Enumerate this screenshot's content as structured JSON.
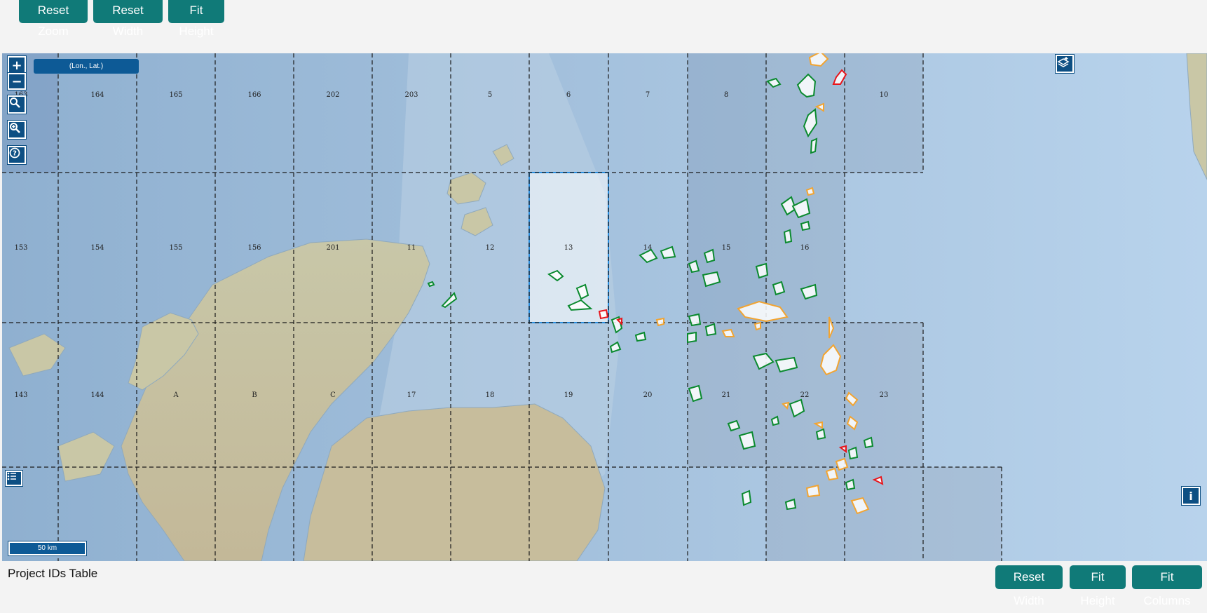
{
  "toolbar": {
    "reset_zoom": "Reset Zoom",
    "reset_width": "Reset Width",
    "fit_height": "Fit Height"
  },
  "map": {
    "coord_display": "(Lon., Lat.)",
    "scale_label": "50 km",
    "zoom_in": "+",
    "zoom_out": "−",
    "info": "i",
    "colors": {
      "sea": "#9bbcd9",
      "land": "#c9c6a4",
      "grid_line": "#1a1a1a",
      "selected_block": "#2b8fe0",
      "green_outline": "#0a8a2e",
      "orange_outline": "#f2a431",
      "red_outline": "#e8141b"
    },
    "row1_labels": [
      "163",
      "164",
      "165",
      "166",
      "202",
      "203",
      "5",
      "6",
      "7",
      "8",
      "10"
    ],
    "row2_labels": [
      "153",
      "154",
      "155",
      "156",
      "201",
      "11",
      "12",
      "13",
      "14",
      "15",
      "16"
    ],
    "row3_labels": [
      "143",
      "144",
      "A",
      "B",
      "C",
      "17",
      "18",
      "19",
      "20",
      "21",
      "22",
      "23"
    ]
  },
  "bottom": {
    "table_title": "Project IDs Table",
    "reset_width": "Reset Width",
    "fit_height": "Fit Height",
    "fit_columns": "Fit Columns"
  }
}
